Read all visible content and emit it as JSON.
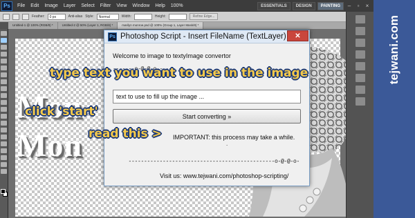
{
  "photoshop": {
    "logo": "Ps",
    "menu": [
      "File",
      "Edit",
      "Image",
      "Layer",
      "Select",
      "Filter",
      "View",
      "Window",
      "Help"
    ],
    "workspaces": [
      "ESSENTIALS",
      "DESIGN",
      "PAINTING"
    ],
    "active_workspace": "PAINTING",
    "zoom": "100%",
    "options": {
      "feather_label": "Feather:",
      "feather_value": "0 px",
      "antialias_label": "Anti-alias",
      "style_label": "Style:",
      "style_value": "Normal",
      "width_label": "Width:",
      "height_label": "Height:",
      "refine_edge_label": "Refine Edge..."
    },
    "tabs": [
      "Untitled-1 @ 100% (RGB/8) *",
      "Untitled-2 @ 50% (Layer 1, RGB/8) *",
      "marilyn monroe.psd @ 100% (Group 1, Layer Mask/8) *"
    ],
    "canvas_words": [
      "Mon",
      "Mon"
    ]
  },
  "dialog": {
    "title": "Photoshop Script - Insert FileName (TextLayer)",
    "close_glyph": "✕",
    "welcome": "Welcome to image to textyImage convertor",
    "deco_top": "-------o-@-@-o------",
    "deco_dot": ".",
    "text_value": "text to use to fill up the image ...",
    "start_label": "Start converting »",
    "important": "IMPORTANT: this process may take a while.",
    "deco_bottom": "-----------------------------------------------o-@-@-o-",
    "visit": "Visit us: www.tejwani.com/photoshop-scripting/"
  },
  "annotations": {
    "type_text": "type text you want to use in the image",
    "click_start": "click 'start'",
    "read_this": "read this >"
  },
  "brand": {
    "text": "tejwani.com",
    "color": "#3b5998"
  },
  "colors": {
    "annotation_fill": "#f5c94a",
    "annotation_outline": "#1d3a78",
    "close_button": "#c9463d"
  }
}
